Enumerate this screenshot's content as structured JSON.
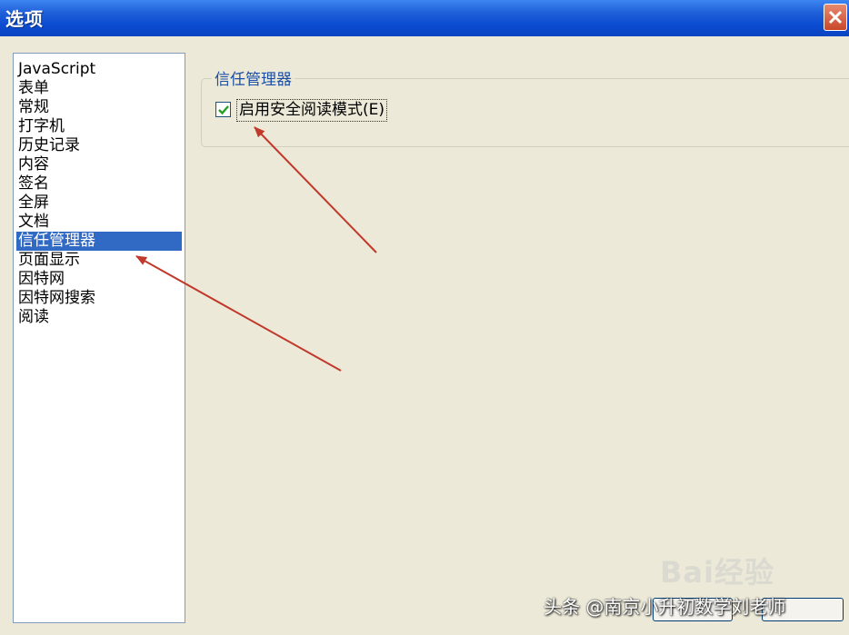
{
  "window": {
    "title": "选项",
    "accent_color": "#0b4bd0"
  },
  "sidebar": {
    "items": [
      {
        "label": "JavaScript"
      },
      {
        "label": "表单"
      },
      {
        "label": "常规"
      },
      {
        "label": "打字机"
      },
      {
        "label": "历史记录"
      },
      {
        "label": "内容"
      },
      {
        "label": "签名"
      },
      {
        "label": "全屏"
      },
      {
        "label": "文档"
      },
      {
        "label": "信任管理器"
      },
      {
        "label": "页面显示"
      },
      {
        "label": "因特网"
      },
      {
        "label": "因特网搜索"
      },
      {
        "label": "阅读"
      }
    ],
    "selected": "信任管理器",
    "selected_color": "#316ac5"
  },
  "main": {
    "group_title": "信任管理器",
    "checkbox": {
      "label": "启用安全阅读模式(E)",
      "checked": true
    }
  },
  "annotations": {
    "arrow_color": "#c0392b",
    "icons": [
      "arrow-to-checkbox",
      "arrow-to-selected-item"
    ]
  },
  "watermarks": {
    "baidu": "Bai经验",
    "credit": "头条 @南京小升初数学刘老师"
  }
}
